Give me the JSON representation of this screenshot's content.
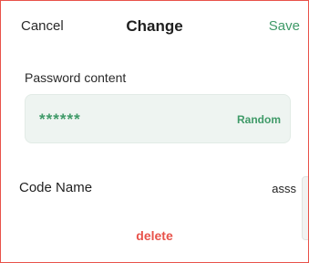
{
  "header": {
    "cancel_label": "Cancel",
    "title": "Change",
    "save_label": "Save"
  },
  "password": {
    "section_label": "Password content",
    "value": "******",
    "random_label": "Random"
  },
  "code_name": {
    "label": "Code Name",
    "value": "asss"
  },
  "actions": {
    "delete_label": "delete"
  },
  "colors": {
    "accent_green": "#3f9a68",
    "danger_red": "#e8524a",
    "field_background": "#eef4f1"
  }
}
